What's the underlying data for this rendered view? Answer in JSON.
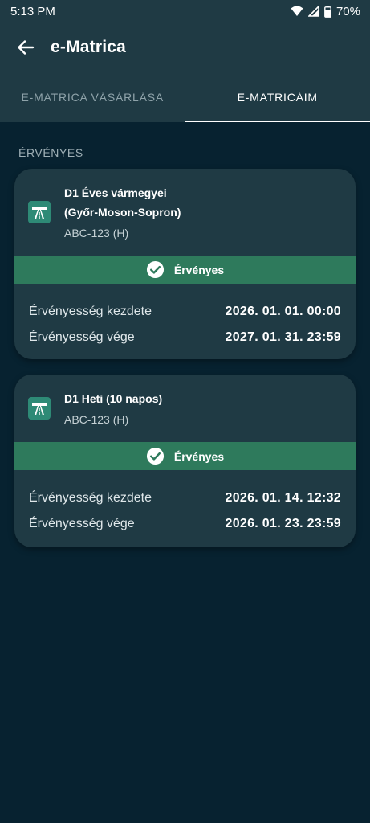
{
  "status_bar": {
    "time": "5:13 PM",
    "battery": "70%",
    "icons": [
      "wifi-icon",
      "signal-icon",
      "battery-icon"
    ]
  },
  "app_bar": {
    "title": "e-Matrica",
    "back_icon": "arrow-left-icon"
  },
  "tabs": [
    {
      "label": "E-MATRICA VÁSÁRLÁSA",
      "active": false
    },
    {
      "label": "E-MATRICÁIM",
      "active": true
    }
  ],
  "section": {
    "label": "ÉRVÉNYES"
  },
  "vignettes": [
    {
      "name_line1": "D1 Éves vármegyei",
      "name_line2": "(Győr-Moson-Sopron)",
      "plate": "ABC-123 (H)",
      "status": "Érvényes",
      "rows": [
        {
          "label": "Érvényesség kezdete",
          "value": "2026. 01. 01. 00:00"
        },
        {
          "label": "Érvényesség vége",
          "value": "2027. 01. 31. 23:59"
        }
      ]
    },
    {
      "name_line1": "D1 Heti (10 napos)",
      "plate": "ABC-123 (H)",
      "status": "Érvényes",
      "rows": [
        {
          "label": "Érvényesség kezdete",
          "value": "2026. 01. 14. 12:32"
        },
        {
          "label": "Érvényesség vége",
          "value": "2026. 01. 23. 23:59"
        }
      ]
    }
  ],
  "colors": {
    "background": "#072230",
    "surface": "#1f3a44",
    "valid_green": "#2e7a5c",
    "road_icon": "#2e8a76"
  }
}
